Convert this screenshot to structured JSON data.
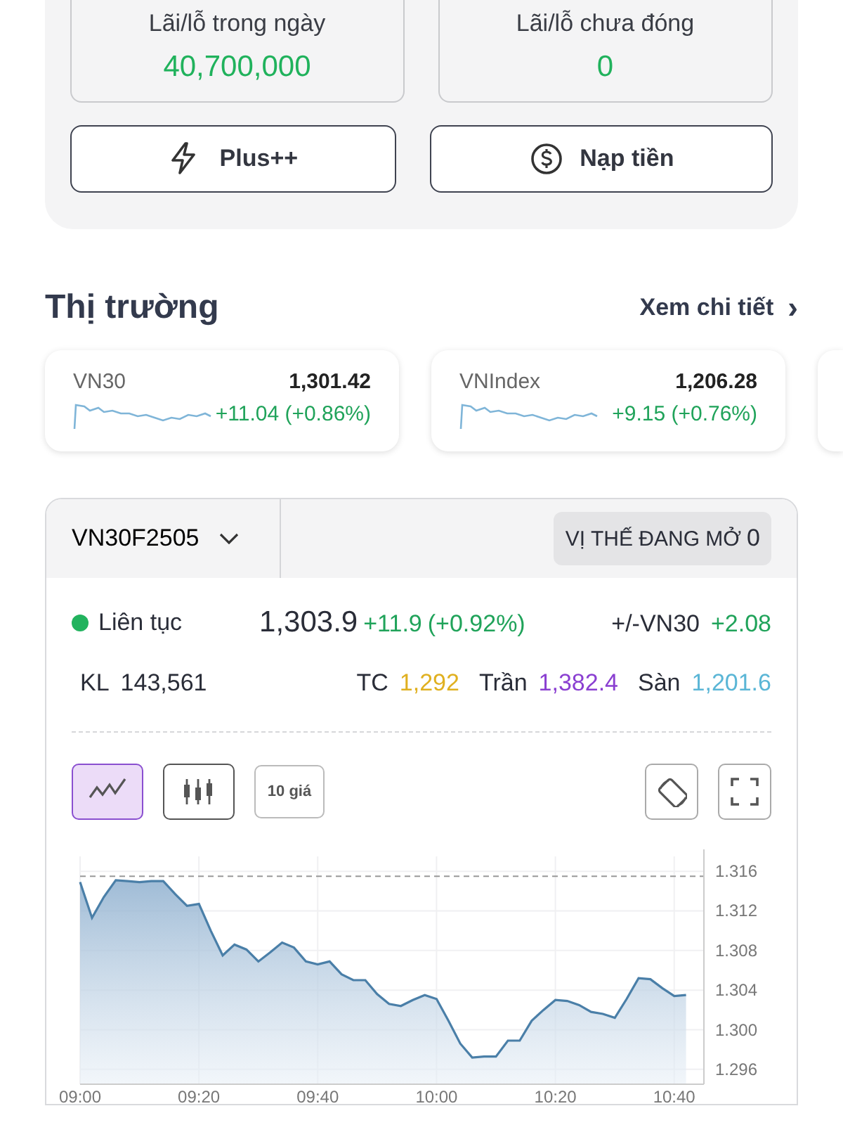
{
  "summary": {
    "stats": [
      {
        "label": "Lãi/lỗ trong ngày",
        "value": "40,700,000"
      },
      {
        "label": "Lãi/lỗ chưa đóng",
        "value": "0"
      }
    ],
    "actions": [
      {
        "kind": "bolt",
        "label": "Plus++"
      },
      {
        "kind": "dollar",
        "label": "Nạp tiền"
      }
    ]
  },
  "market": {
    "title": "Thị trường",
    "link": "Xem chi tiết",
    "chevron": "›",
    "indices": [
      {
        "name": "VN30",
        "price": "1,301.42",
        "change": "+11.04 (+0.86%)"
      },
      {
        "name": "VNIndex",
        "price": "1,206.28",
        "change": "+9.15 (+0.76%)"
      }
    ],
    "more_cards_peek": true
  },
  "futures": {
    "symbol": "VN30F2505",
    "open_positions_label": "VỊ THẾ ĐANG MỞ",
    "open_positions": "0",
    "session": {
      "label": "Liên tục",
      "color": "#22b35e"
    },
    "price": "1,303.9",
    "change": "+11.9",
    "change_pct": "(+0.92%)",
    "basis_label": "+/-VN30",
    "basis": "+2.08",
    "volume_label": "KL",
    "volume": "143,561",
    "levels": [
      {
        "label": "TC",
        "value": "1,292",
        "color": "#e0b020"
      },
      {
        "label": "Trần",
        "value": "1,382.4",
        "color": "#8a3fd1"
      },
      {
        "label": "Sàn",
        "value": "1,201.6",
        "color": "#5bb6d6"
      }
    ],
    "chart_modes": [
      {
        "kind": "line",
        "selected": true
      },
      {
        "kind": "candles",
        "selected": false
      },
      {
        "kind": "depth",
        "label": "10 giá",
        "selected": false
      }
    ],
    "chart_tools": [
      {
        "kind": "rotate"
      },
      {
        "kind": "fullscreen"
      }
    ],
    "chart_data": {
      "type": "area",
      "categories": [
        "09:00",
        null,
        null,
        null,
        null,
        null,
        null,
        null,
        null,
        null,
        "09:20",
        null,
        null,
        null,
        null,
        null,
        null,
        null,
        null,
        null,
        "09:40",
        null,
        null,
        null,
        null,
        null,
        null,
        null,
        null,
        null,
        "10:00",
        null,
        null,
        null,
        null,
        null,
        null,
        null,
        null,
        null,
        "10:20",
        null,
        null,
        null,
        null,
        null,
        null,
        null,
        null,
        null,
        "10:40",
        null
      ],
      "series": [
        {
          "color": "#4a7fa8",
          "values": [
            1.3149,
            1.3113,
            1.3134,
            1.3151,
            1.315,
            1.3149,
            1.315,
            1.315,
            1.3137,
            1.3125,
            1.3127,
            1.31,
            1.3075,
            1.3086,
            1.3081,
            1.3069,
            1.3078,
            1.3088,
            1.3083,
            1.3069,
            1.3066,
            1.3069,
            1.3056,
            1.305,
            1.305,
            1.3036,
            1.3026,
            1.3024,
            1.303,
            1.3035,
            1.3031,
            1.3009,
            1.2986,
            1.2972,
            1.2973,
            1.2973,
            1.2989,
            1.2989,
            1.3009,
            1.302,
            1.303,
            1.3029,
            1.3025,
            1.3018,
            1.3016,
            1.3012,
            1.3031,
            1.3052,
            1.3051,
            1.3042,
            1.3034,
            1.3035
          ]
        }
      ],
      "ylim": [
        1.2945,
        1.3175
      ],
      "yticks": [
        {
          "value": 1.296,
          "label": "1.296"
        },
        {
          "value": 1.3,
          "label": "1.300"
        },
        {
          "value": 1.304,
          "label": "1.304"
        },
        {
          "value": 1.308,
          "label": "1.308"
        },
        {
          "value": 1.312,
          "label": "1.312"
        },
        {
          "value": 1.316,
          "label": "1.316"
        }
      ],
      "grid": true,
      "ref_lines": [
        {
          "axis": "y",
          "value": 1.3155
        }
      ]
    }
  }
}
